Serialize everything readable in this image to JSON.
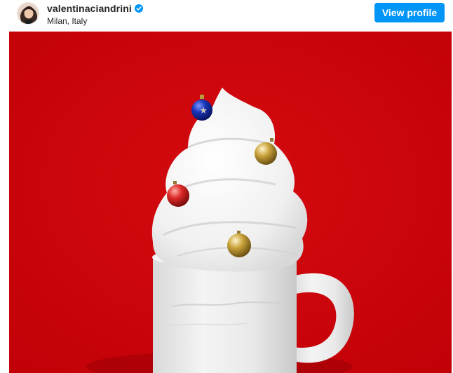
{
  "post": {
    "username": "valentinaciandrini",
    "verified_icon": "verified-badge-icon",
    "location": "Milan, Italy",
    "view_profile_label": "View profile"
  },
  "media": {
    "description_icon": "photo",
    "background_color": "#cc0009",
    "accent_color": "#0095f6"
  }
}
